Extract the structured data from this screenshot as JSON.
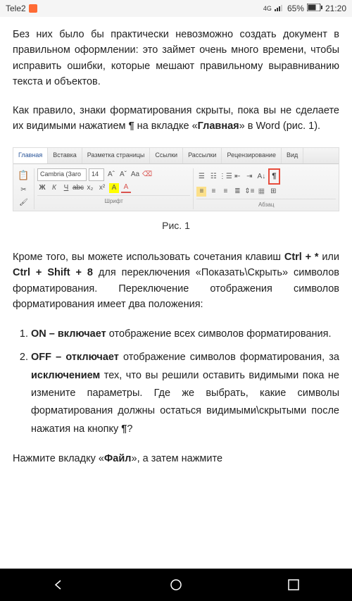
{
  "status": {
    "carrier": "Tele2",
    "network": "4G",
    "battery": "65%",
    "time": "21:20"
  },
  "doc": {
    "p1": "Без них было бы практически невозможно создать документ в правильном оформлении: это займет очень много времени, чтобы исправить ошибки, которые мешают правильному выравниванию текста и объектов.",
    "p2a": "Как правило, знаки форматирования скрыты, пока вы не сделаете их видимыми нажатием ",
    "p2_pilcrow": "¶",
    "p2b": " на вкладке «",
    "p2_bold": "Главная",
    "p2c": "» в Word (рис. 1).",
    "caption": "Рис. 1",
    "p3a": "Кроме того, вы можете использовать сочетания клавиш ",
    "p3_k1": "Ctrl + *",
    "p3b": " или ",
    "p3_k2": "Ctrl + Shift + 8",
    "p3c": " для переключения «Показать\\Скрыть» символов форматирования. Переключение отображения символов форматирования имеет два положения:",
    "li1_a": "ON – включает",
    "li1_b": " отображение всех символов форматирования.",
    "li2_a": "OFF – отключает",
    "li2_b": " отображение символов форматирования, за ",
    "li2_c": "исключением",
    "li2_d": " тех, что вы решили оставить видимыми пока не измените параметры. Где же выбрать, какие символы форматирования должны остаться видимыми\\скрытыми после нажатия на кнопку ",
    "li2_pilcrow": "¶",
    "li2_e": "?",
    "p4a": "Нажмите вкладку «",
    "p4_bold": "Файл",
    "p4b": "», а затем нажмите"
  },
  "ribbon": {
    "tabs": [
      "Главная",
      "Вставка",
      "Разметка страницы",
      "Ссылки",
      "Рассылки",
      "Рецензирование",
      "Вид"
    ],
    "font_name": "Cambria (Заго",
    "font_size": "14",
    "group_font": "Шрифт",
    "group_para": "Абзац",
    "pilcrow": "¶"
  }
}
